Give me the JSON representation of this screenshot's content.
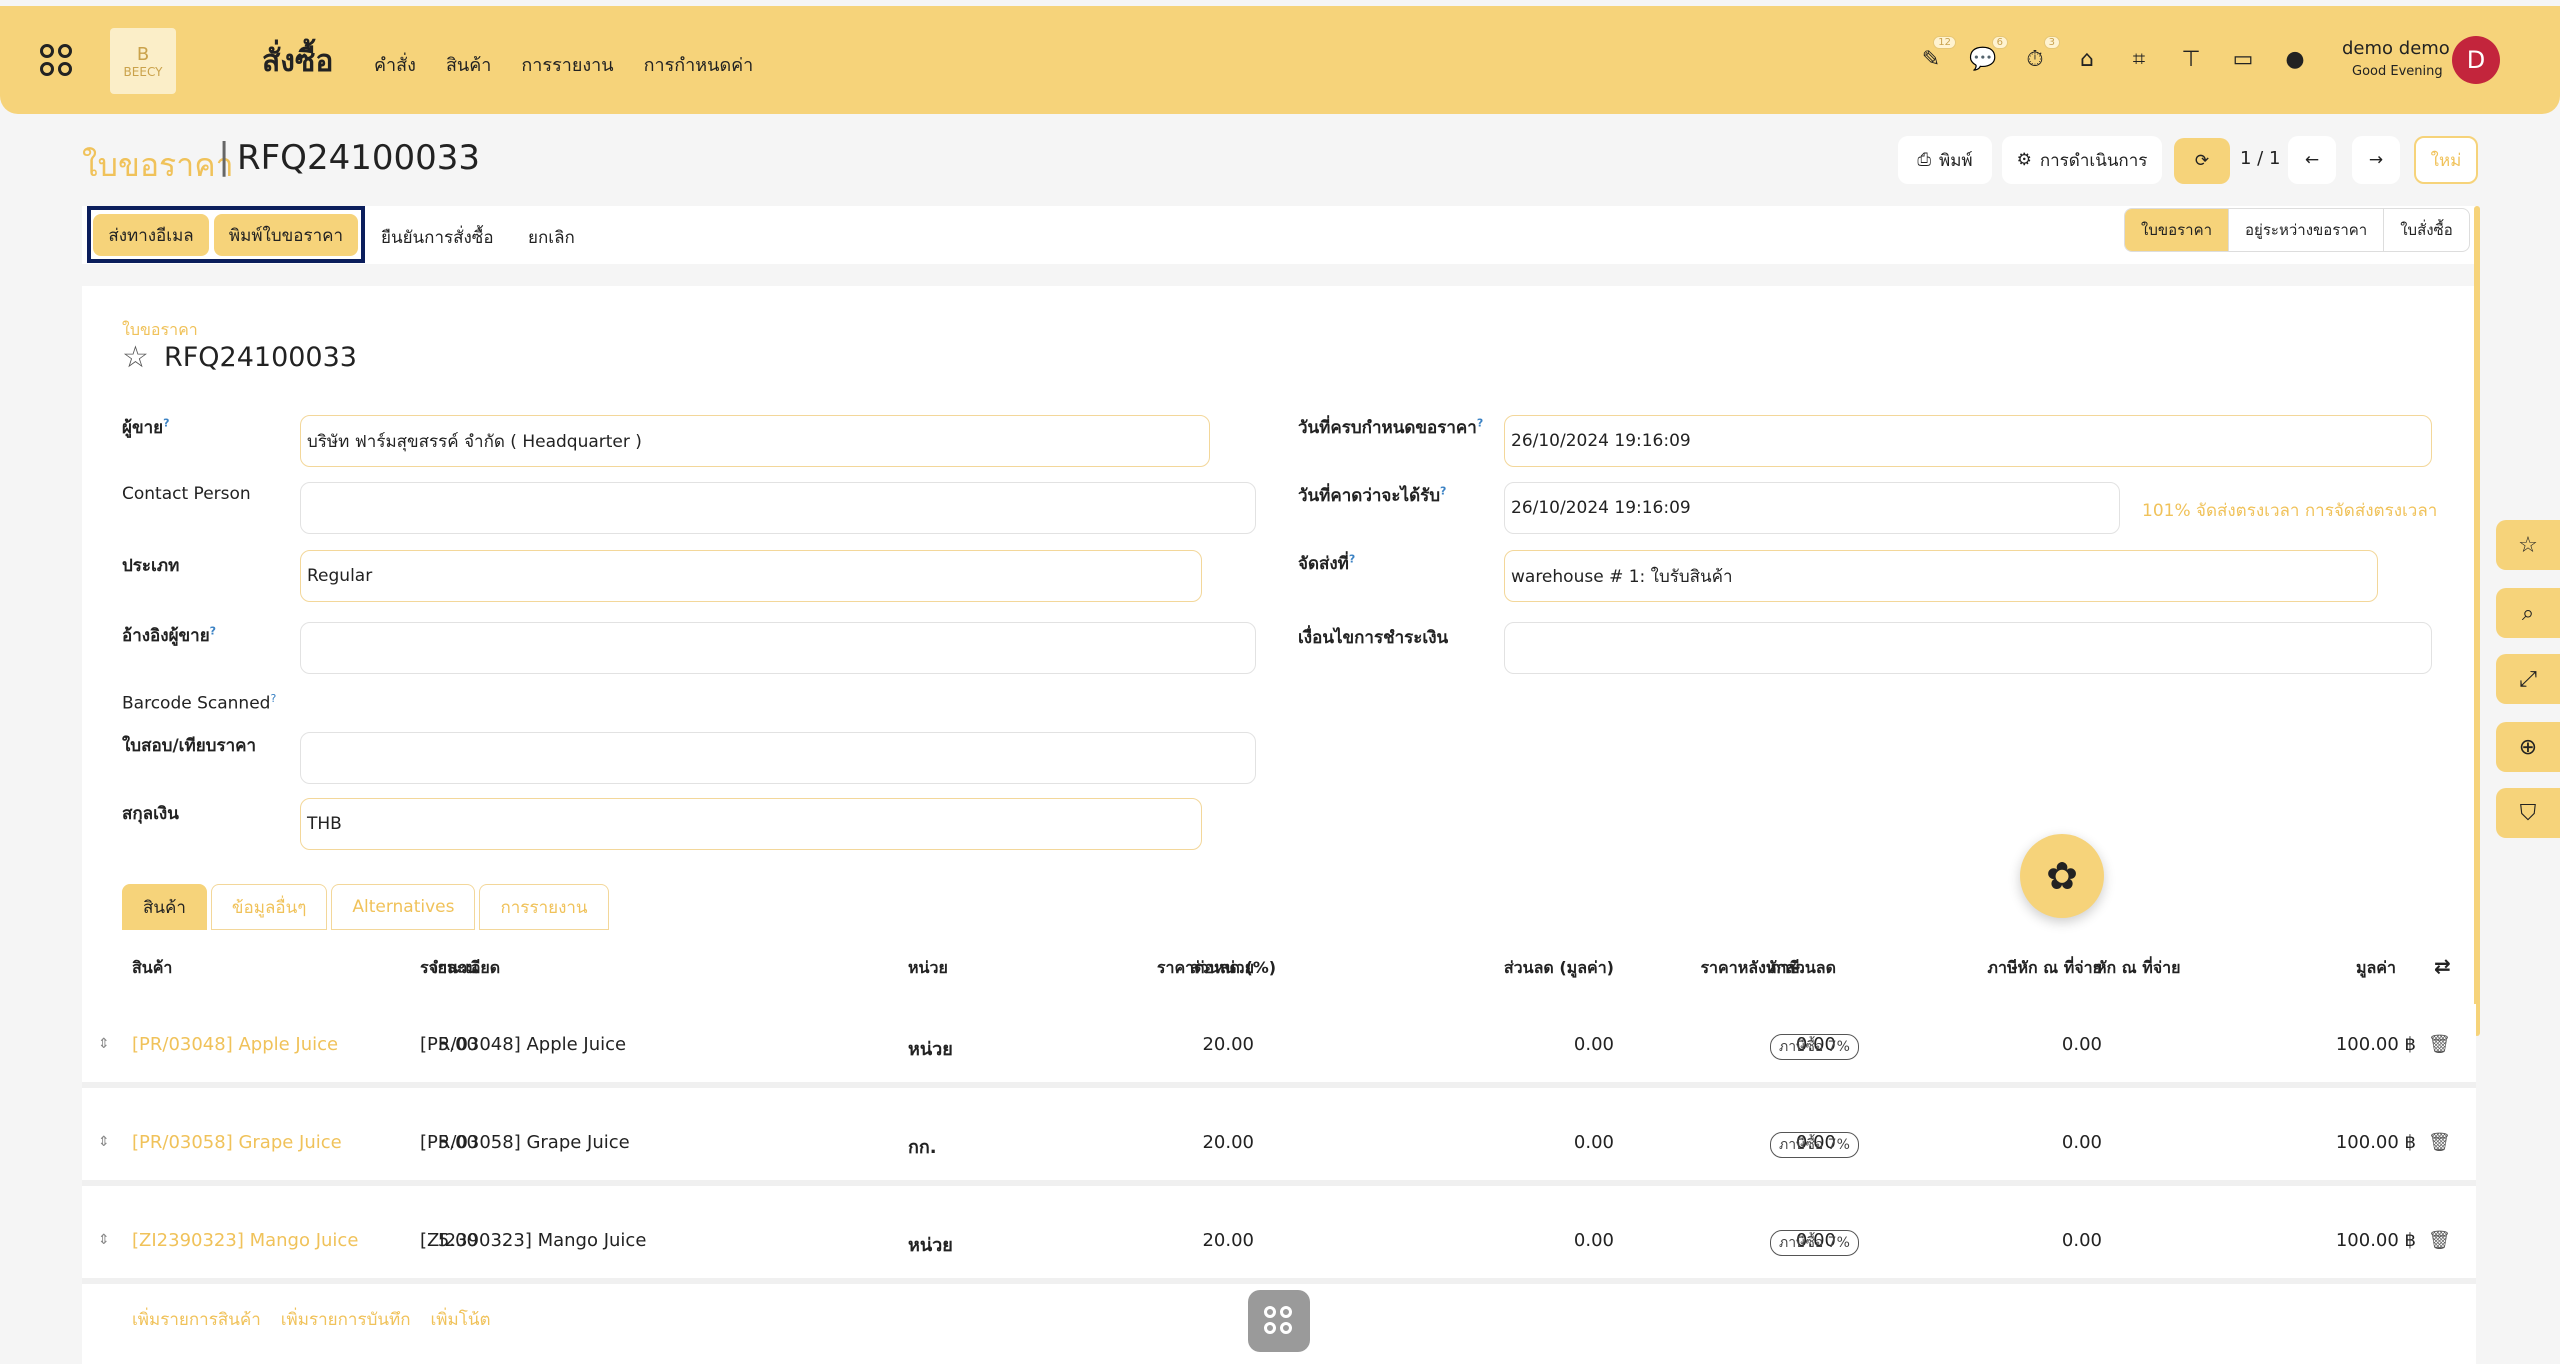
{
  "header": {
    "logo_text": "BEECY",
    "logo_mark": "B",
    "app_title": "สั่งซื้อ",
    "menu": [
      "คำสั่ง",
      "สินค้า",
      "การรายงาน",
      "การกำหนดค่า"
    ],
    "tray_badges": {
      "activity": "12",
      "messages": "6",
      "timer": "3"
    },
    "user_name": "demo demo",
    "user_greeting": "Good Evening",
    "avatar_letter": "D",
    "avatar_color": "#c3253c"
  },
  "breadcrumb": {
    "parent": "ใบขอราคา",
    "separator": "|",
    "current": "RFQ24100033"
  },
  "controls": {
    "print": "พิมพ์",
    "action": "การดำเนินการ",
    "pager": "1 / 1",
    "new": "ใหม่"
  },
  "status_buttons": {
    "send_email": "ส่งทางอีเมล",
    "print_rfq": "พิมพ์ใบขอราคา",
    "confirm_order": "ยืนยันการสั่งซื้อ",
    "cancel": "ยกเลิก"
  },
  "stages": [
    "ใบขอราคา",
    "อยู่ระหว่างขอราคา",
    "ใบสั่งซื้อ"
  ],
  "form": {
    "doc_type": "ใบขอราคา",
    "doc_name": "RFQ24100033",
    "vendor_label": "ผู้ขาย",
    "vendor_value": "บริษัท ฟาร์มสุขสรรค์ จำกัด ( Headquarter )",
    "contact_label": "Contact Person",
    "contact_value": "",
    "type_label": "ประเภท",
    "type_value": "Regular",
    "vendor_ref_label": "อ้างอิงผู้ขาย",
    "vendor_ref_value": "",
    "barcode_label": "Barcode Scanned",
    "rfq_compare_label": "ใบสอบ/เทียบราคา",
    "rfq_compare_value": "",
    "currency_label": "สกุลเงิน",
    "currency_value": "THB",
    "deadline_label": "วันที่ครบกำหนดขอราคา",
    "deadline_value": "26/10/2024 19:16:09",
    "expected_label": "วันที่คาดว่าจะได้รับ",
    "expected_value": "26/10/2024 19:16:09",
    "on_time_text": "101% จัดส่งตรงเวลา การจัดส่งตรงเวลา",
    "deliver_to_label": "จัดส่งที่",
    "deliver_to_value": "warehouse # 1: ใบรับสินค้า",
    "payment_terms_label": "เงื่อนไขการชำระเงิน",
    "payment_terms_value": "",
    "help_mark": "?"
  },
  "tabs": [
    "สินค้า",
    "ข้อมูลอื่นๆ",
    "Alternatives",
    "การรายงาน"
  ],
  "table": {
    "headers": [
      "สินค้า",
      "รายละเอียด",
      "จำนวน",
      "หน่วย",
      "ราคาต่อหน่วย",
      "ส่วนลด (%)",
      "ส่วนลด (มูลค่า)",
      "ราคาหลังหักส่วนลด",
      "ภาษี",
      "ภาษีหัก ณ ที่จ่าย",
      "หัก ณ ที่จ่าย",
      "มูลค่า"
    ],
    "rows": [
      {
        "product": "[PR/03048] Apple Juice",
        "desc": "[PR/03048] Apple Juice",
        "qty": "5.00",
        "uom": "หน่วย",
        "price": "20.00",
        "disc_amt": "0.00",
        "after_disc": "0.00",
        "tax": "ภาษีซื้อ 7%",
        "wht": "0.00",
        "subtotal": "100.00 ฿"
      },
      {
        "product": "[PR/03058] Grape Juice",
        "desc": "[PR/03058] Grape Juice",
        "qty": "5.00",
        "uom": "กก.",
        "price": "20.00",
        "disc_amt": "0.00",
        "after_disc": "0.00",
        "tax": "ภาษีซื้อ 7%",
        "wht": "0.00",
        "subtotal": "100.00 ฿"
      },
      {
        "product": "[ZI2390323] Mango Juice",
        "desc": "[ZI2390323] Mango Juice",
        "qty": "5.00",
        "uom": "หน่วย",
        "price": "20.00",
        "disc_amt": "0.00",
        "after_disc": "0.00",
        "tax": "ภาษีซื้อ 7%",
        "wht": "0.00",
        "subtotal": "100.00 ฿"
      }
    ],
    "add_links": [
      "เพิ่มรายการสินค้า",
      "เพิ่มรายการบันทึก",
      "เพิ่มโน้ต"
    ]
  },
  "colors": {
    "accent": "#f6d37a",
    "accent_text": "#f0c25a",
    "highlight_border": "#0b1e5c"
  }
}
